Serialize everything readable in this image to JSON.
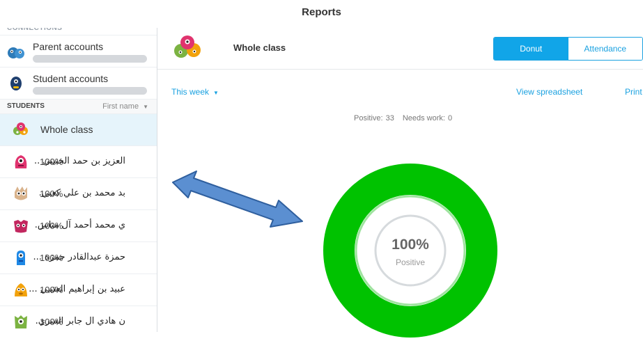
{
  "topbar": {
    "title": "Reports"
  },
  "sidebar": {
    "section_cut": "CONNECTIONS",
    "accounts": [
      {
        "label": "Parent accounts",
        "icon": "parent-monster-icon"
      },
      {
        "label": "Student accounts",
        "icon": "student-monster-icon"
      }
    ],
    "students_header": {
      "label": "STUDENTS",
      "sort": "First name"
    },
    "whole_class": {
      "label": "Whole class"
    },
    "students": [
      {
        "pct": "100%",
        "name": "العزيز بن حمد الخنيني ..",
        "color": "#e0336e"
      },
      {
        "pct": "100%",
        "name": "بد محمد بن علي كعبي.",
        "color": "#7a5c3a"
      },
      {
        "pct": "100%",
        "name": "ي محمد أحمد آل مناس.",
        "color": "#c2275f"
      },
      {
        "pct": "100%",
        "name": "حمزة عبدالقادر حمزة ...",
        "color": "#1e88e5"
      },
      {
        "pct": "100%",
        "name": "عبيد بن إبراهيم العتيبي ...",
        "color": "#f2a20c"
      },
      {
        "pct": "100%",
        "name": "ن هادي ال جابر السري.",
        "color": "#7cb342"
      }
    ]
  },
  "main": {
    "class_title": "Whole class",
    "tabs": {
      "donut": "Donut",
      "attendance": "Attendance"
    },
    "range": "This week",
    "view_spreadsheet": "View spreadsheet",
    "print": "Print",
    "summary": {
      "positive_label": "Positive:",
      "positive_value": "33",
      "needs_label": "Needs work:",
      "needs_value": "0"
    },
    "donut": {
      "pct": "100%",
      "label": "Positive"
    }
  },
  "colors": {
    "accent": "#11a5e8",
    "positive": "#00c200",
    "selected_row": "#e6f4fb"
  },
  "chart_data": {
    "type": "pie",
    "categories": [
      "Positive",
      "Needs work"
    ],
    "values": [
      33,
      0
    ]
  }
}
